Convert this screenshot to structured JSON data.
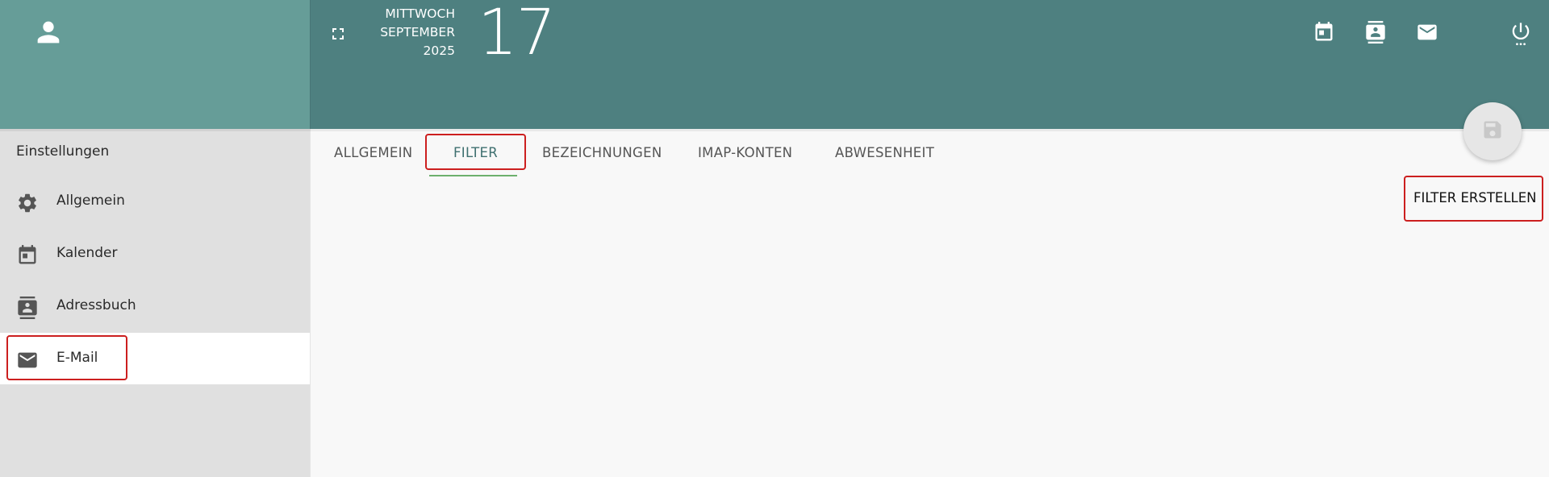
{
  "header": {
    "weekday": "MITTWOCH",
    "month": "SEPTEMBER",
    "year": "2025",
    "day": "17"
  },
  "icons": {
    "avatar": "person-icon",
    "fullscreen": "fullscreen-icon",
    "calendar": "calendar-icon",
    "contacts": "contacts-icon",
    "mail": "mail-icon",
    "power": "power-icon",
    "save": "save-icon"
  },
  "sidebar": {
    "title": "Einstellungen",
    "items": [
      {
        "label": "Allgemein",
        "icon": "gear-icon"
      },
      {
        "label": "Kalender",
        "icon": "calendar-icon"
      },
      {
        "label": "Adressbuch",
        "icon": "contacts-icon"
      },
      {
        "label": "E-Mail",
        "icon": "mail-icon",
        "active": true
      }
    ]
  },
  "tabs": [
    {
      "label": "ALLGEMEIN"
    },
    {
      "label": "FILTER",
      "active": true
    },
    {
      "label": "BEZEICHNUNGEN"
    },
    {
      "label": "IMAP-KONTEN"
    },
    {
      "label": "ABWESENHEIT"
    }
  ],
  "actions": {
    "create_filter": "FILTER ERSTELLEN"
  },
  "colors": {
    "header": "#4e8080",
    "left_header": "#669d98",
    "sidebar": "#e0e0e0",
    "highlight": "#cc1f1f",
    "tab_underline": "#6db06d"
  }
}
